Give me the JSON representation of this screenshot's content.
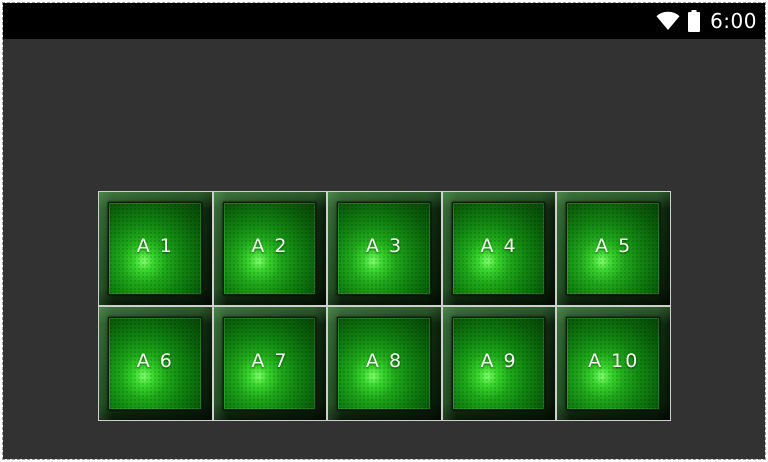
{
  "status_bar": {
    "time": "6:00",
    "icons": [
      "wifi-icon",
      "battery-icon"
    ]
  },
  "pads": [
    {
      "label": "A 1"
    },
    {
      "label": "A 2"
    },
    {
      "label": "A 3"
    },
    {
      "label": "A 4"
    },
    {
      "label": "A 5"
    },
    {
      "label": "A 6"
    },
    {
      "label": "A 7"
    },
    {
      "label": "A 8"
    },
    {
      "label": "A 9"
    },
    {
      "label": "A 10"
    }
  ],
  "colors": {
    "background": "#323232",
    "status_bar": "#000000",
    "pad_glow": "#38d62c",
    "pad_dark": "#0a5e0a",
    "grid_line": "#cfcfcf"
  }
}
